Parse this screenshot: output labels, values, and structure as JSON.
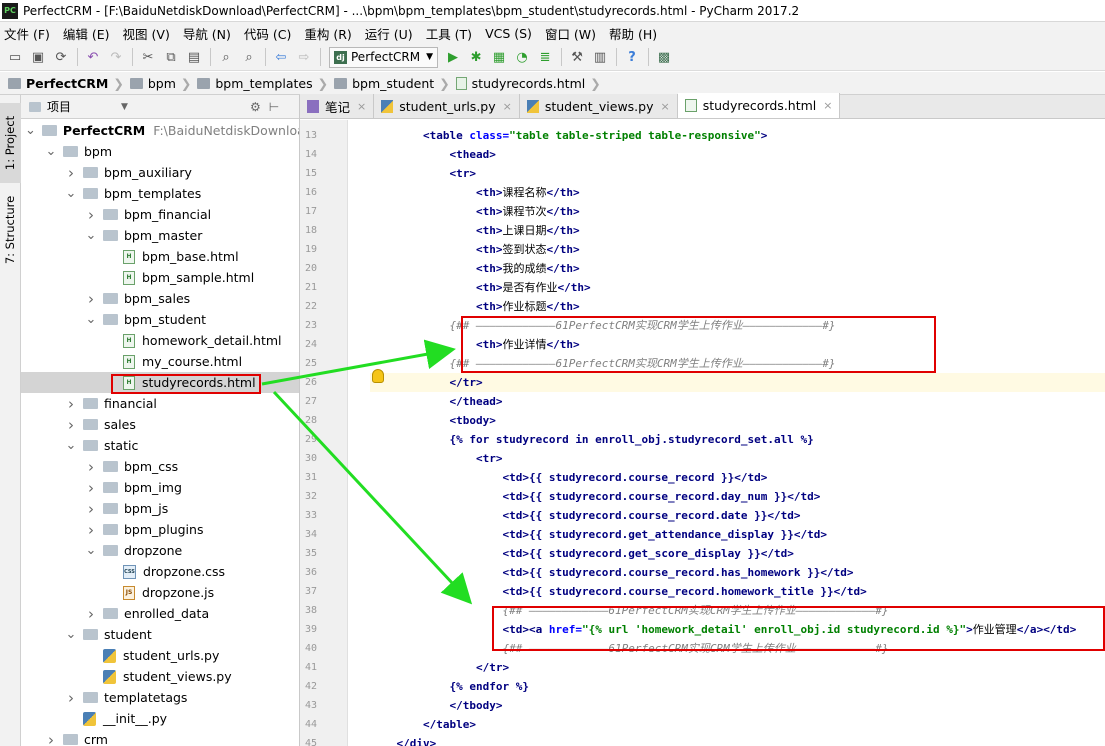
{
  "window": {
    "title": "PerfectCRM - [F:\\BaiduNetdiskDownload\\PerfectCRM] - ...\\bpm\\bpm_templates\\bpm_student\\studyrecords.html - PyCharm 2017.2",
    "logo": "PC"
  },
  "menu": [
    "文件 (F)",
    "编辑 (E)",
    "视图 (V)",
    "导航 (N)",
    "代码 (C)",
    "重构 (R)",
    "运行 (U)",
    "工具 (T)",
    "VCS (S)",
    "窗口 (W)",
    "帮助 (H)"
  ],
  "toolbar": {
    "run_config": "PerfectCRM",
    "run_config_icon": "dj"
  },
  "breadcrumb": [
    "PerfectCRM",
    "bpm",
    "bpm_templates",
    "bpm_student",
    "studyrecords.html"
  ],
  "side_tabs": {
    "project": "1: Project",
    "structure": "7: Structure"
  },
  "project_panel": {
    "title": "项目"
  },
  "tree": [
    {
      "label": "PerfectCRM",
      "hint": "F:\\BaiduNetdiskDownload\\",
      "kind": "folder",
      "expanded": true
    },
    {
      "label": "bpm",
      "kind": "folder",
      "expanded": true
    },
    {
      "label": "bpm_auxiliary",
      "kind": "folder",
      "expanded": false
    },
    {
      "label": "bpm_templates",
      "kind": "folder",
      "expanded": true
    },
    {
      "label": "bpm_financial",
      "kind": "folder",
      "expanded": false
    },
    {
      "label": "bpm_master",
      "kind": "folder",
      "expanded": true
    },
    {
      "label": "bpm_base.html",
      "kind": "html"
    },
    {
      "label": "bpm_sample.html",
      "kind": "html"
    },
    {
      "label": "bpm_sales",
      "kind": "folder",
      "expanded": false
    },
    {
      "label": "bpm_student",
      "kind": "folder",
      "expanded": true
    },
    {
      "label": "homework_detail.html",
      "kind": "html"
    },
    {
      "label": "my_course.html",
      "kind": "html"
    },
    {
      "label": "studyrecords.html",
      "kind": "html",
      "selected": true
    },
    {
      "label": "financial",
      "kind": "folder",
      "expanded": false
    },
    {
      "label": "sales",
      "kind": "folder",
      "expanded": false
    },
    {
      "label": "static",
      "kind": "folder",
      "expanded": true
    },
    {
      "label": "bpm_css",
      "kind": "folder",
      "expanded": false
    },
    {
      "label": "bpm_img",
      "kind": "folder",
      "expanded": false
    },
    {
      "label": "bpm_js",
      "kind": "folder",
      "expanded": false
    },
    {
      "label": "bpm_plugins",
      "kind": "folder",
      "expanded": false
    },
    {
      "label": "dropzone",
      "kind": "folder",
      "expanded": true
    },
    {
      "label": "dropzone.css",
      "kind": "css"
    },
    {
      "label": "dropzone.js",
      "kind": "js"
    },
    {
      "label": "enrolled_data",
      "kind": "folder",
      "expanded": false
    },
    {
      "label": "student",
      "kind": "folder",
      "expanded": true
    },
    {
      "label": "student_urls.py",
      "kind": "py"
    },
    {
      "label": "student_views.py",
      "kind": "py"
    },
    {
      "label": "templatetags",
      "kind": "folder",
      "expanded": false
    },
    {
      "label": "__init__.py",
      "kind": "py"
    },
    {
      "label": "crm",
      "kind": "folder",
      "expanded": false
    }
  ],
  "editor_tabs": [
    {
      "label": "笔记",
      "icon": "notes",
      "active": false
    },
    {
      "label": "student_urls.py",
      "icon": "py",
      "active": false
    },
    {
      "label": "student_views.py",
      "icon": "py",
      "active": false
    },
    {
      "label": "studyrecords.html",
      "icon": "html",
      "active": true
    }
  ],
  "code": {
    "current_line": 26,
    "lines": [
      {
        "n": 13,
        "text": "        <table class=\"table table-striped table-responsive\">"
      },
      {
        "n": 14,
        "text": "            <thead>"
      },
      {
        "n": 15,
        "text": "            <tr>"
      },
      {
        "n": 16,
        "text": "                <th>课程名称</th>"
      },
      {
        "n": 17,
        "text": "                <th>课程节次</th>"
      },
      {
        "n": 18,
        "text": "                <th>上课日期</th>"
      },
      {
        "n": 19,
        "text": "                <th>签到状态</th>"
      },
      {
        "n": 20,
        "text": "                <th>我的成绩</th>"
      },
      {
        "n": 21,
        "text": "                <th>是否有作业</th>"
      },
      {
        "n": 22,
        "text": "                <th>作业标题</th>"
      },
      {
        "n": 23,
        "text": "            {## ————————————61PerfectCRM实现CRM学生上传作业————————————#}"
      },
      {
        "n": 24,
        "text": "                <th>作业详情</th>"
      },
      {
        "n": 25,
        "text": "            {## ————————————61PerfectCRM实现CRM学生上传作业————————————#}"
      },
      {
        "n": 26,
        "text": "            </tr>"
      },
      {
        "n": 27,
        "text": "            </thead>"
      },
      {
        "n": 28,
        "text": "            <tbody>"
      },
      {
        "n": 29,
        "text": "            {% for studyrecord in enroll_obj.studyrecord_set.all %}"
      },
      {
        "n": 30,
        "text": "                <tr>"
      },
      {
        "n": 31,
        "text": "                    <td>{{ studyrecord.course_record }}</td>"
      },
      {
        "n": 32,
        "text": "                    <td>{{ studyrecord.course_record.day_num }}</td>"
      },
      {
        "n": 33,
        "text": "                    <td>{{ studyrecord.course_record.date }}</td>"
      },
      {
        "n": 34,
        "text": "                    <td>{{ studyrecord.get_attendance_display }}</td>"
      },
      {
        "n": 35,
        "text": "                    <td>{{ studyrecord.get_score_display }}</td>"
      },
      {
        "n": 36,
        "text": "                    <td>{{ studyrecord.course_record.has_homework }}</td>"
      },
      {
        "n": 37,
        "text": "                    <td>{{ studyrecord.course_record.homework_title }}</td>"
      },
      {
        "n": 38,
        "text": "                    {## ————————————61PerfectCRM实现CRM学生上传作业————————————#}"
      },
      {
        "n": 39,
        "text": "                    <td><a href=\"{% url 'homework_detail' enroll_obj.id studyrecord.id %}\">作业管理</a></td>"
      },
      {
        "n": 40,
        "text": "                    {## ————————————61PerfectCRM实现CRM学生上传作业————————————#}"
      },
      {
        "n": 41,
        "text": "                </tr>"
      },
      {
        "n": 42,
        "text": "            {% endfor %}"
      },
      {
        "n": 43,
        "text": "            </tbody>"
      },
      {
        "n": 44,
        "text": "        </table>"
      },
      {
        "n": 45,
        "text": "    </div>"
      }
    ]
  },
  "colors": {
    "highlight_box": "#e00000",
    "arrow": "#22dd22",
    "tag": "#000080",
    "string": "#008000",
    "comment": "#808080"
  }
}
